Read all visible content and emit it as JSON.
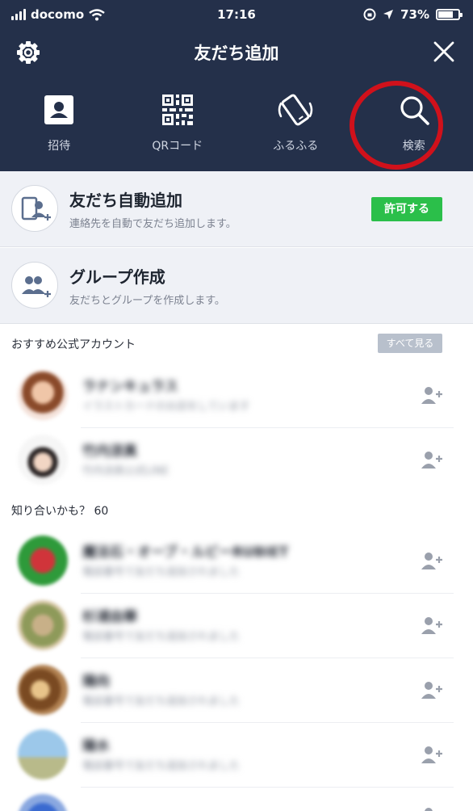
{
  "status_bar": {
    "carrier": "docomo",
    "time": "17:16",
    "battery": "73%",
    "battery_level": 0.73
  },
  "header": {
    "title": "友だち追加"
  },
  "actions": [
    {
      "label": "招待",
      "icon": "contact-book-icon"
    },
    {
      "label": "QRコード",
      "icon": "qr-code-icon"
    },
    {
      "label": "ふるふる",
      "icon": "shake-phone-icon"
    },
    {
      "label": "検索",
      "icon": "search-icon"
    }
  ],
  "auto_add": {
    "title": "友だち自動追加",
    "subtitle": "連絡先を自動で友だち追加します。",
    "button": "許可する"
  },
  "group": {
    "title": "グループ作成",
    "subtitle": "友だちとグループを作成します。"
  },
  "official": {
    "header": "おすすめ公式アカウント",
    "see_all": "すべて見る",
    "items": [
      {
        "name": "ラナンキュラス",
        "desc": "イラストカードのお店をしています"
      },
      {
        "name": "竹内涼真",
        "desc": "竹内涼真公式LINE"
      }
    ]
  },
  "suggest": {
    "header": "知り合いかも？ 60",
    "items": [
      {
        "name": "魔法石・オーブ・ルビーRUBIET",
        "desc": "電話番号で友だち追加されました"
      },
      {
        "name": "杉浦由華",
        "desc": "電話番号で友だち追加されました"
      },
      {
        "name": "陽向",
        "desc": "電話番号で友だち追加されました"
      },
      {
        "name": "陽水",
        "desc": "電話番号で友だち追加されました"
      }
    ]
  },
  "colors": {
    "header_bg": "#24304a",
    "accent_green": "#2bbf4a",
    "highlight_ring": "#d0111b"
  }
}
